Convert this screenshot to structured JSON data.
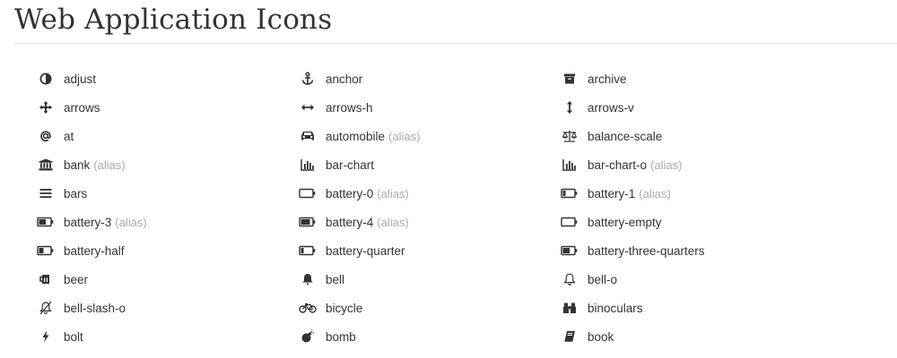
{
  "page": {
    "title": "Web Application Icons"
  },
  "colors": {
    "text": "#333333",
    "muted": "#aaaaaa",
    "rule": "#e5e5e5"
  },
  "alias_label": "(alias)",
  "icons": [
    {
      "name": "adjust",
      "icon": "adjust-icon",
      "alias": false
    },
    {
      "name": "anchor",
      "icon": "anchor-icon",
      "alias": false
    },
    {
      "name": "archive",
      "icon": "archive-icon",
      "alias": false
    },
    {
      "name": "arrows",
      "icon": "arrows-icon",
      "alias": false
    },
    {
      "name": "arrows-h",
      "icon": "arrows-h-icon",
      "alias": false
    },
    {
      "name": "arrows-v",
      "icon": "arrows-v-icon",
      "alias": false
    },
    {
      "name": "at",
      "icon": "at-icon",
      "alias": false
    },
    {
      "name": "automobile",
      "icon": "automobile-icon",
      "alias": true
    },
    {
      "name": "balance-scale",
      "icon": "balance-scale-icon",
      "alias": false
    },
    {
      "name": "bank",
      "icon": "bank-icon",
      "alias": true
    },
    {
      "name": "bar-chart",
      "icon": "bar-chart-icon",
      "alias": false
    },
    {
      "name": "bar-chart-o",
      "icon": "bar-chart-o-icon",
      "alias": true
    },
    {
      "name": "bars",
      "icon": "bars-icon",
      "alias": false
    },
    {
      "name": "battery-0",
      "icon": "battery-0-icon",
      "alias": true
    },
    {
      "name": "battery-1",
      "icon": "battery-1-icon",
      "alias": true
    },
    {
      "name": "battery-3",
      "icon": "battery-3-icon",
      "alias": true
    },
    {
      "name": "battery-4",
      "icon": "battery-4-icon",
      "alias": true
    },
    {
      "name": "battery-empty",
      "icon": "battery-empty-icon",
      "alias": false
    },
    {
      "name": "battery-half",
      "icon": "battery-half-icon",
      "alias": false
    },
    {
      "name": "battery-quarter",
      "icon": "battery-quarter-icon",
      "alias": false
    },
    {
      "name": "battery-three-quarters",
      "icon": "battery-three-quarters-icon",
      "alias": false
    },
    {
      "name": "beer",
      "icon": "beer-icon",
      "alias": false
    },
    {
      "name": "bell",
      "icon": "bell-icon",
      "alias": false
    },
    {
      "name": "bell-o",
      "icon": "bell-o-icon",
      "alias": false
    },
    {
      "name": "bell-slash-o",
      "icon": "bell-slash-o-icon",
      "alias": false
    },
    {
      "name": "bicycle",
      "icon": "bicycle-icon",
      "alias": false
    },
    {
      "name": "binoculars",
      "icon": "binoculars-icon",
      "alias": false
    },
    {
      "name": "bolt",
      "icon": "bolt-icon",
      "alias": false
    },
    {
      "name": "bomb",
      "icon": "bomb-icon",
      "alias": false
    },
    {
      "name": "book",
      "icon": "book-icon",
      "alias": false
    }
  ]
}
